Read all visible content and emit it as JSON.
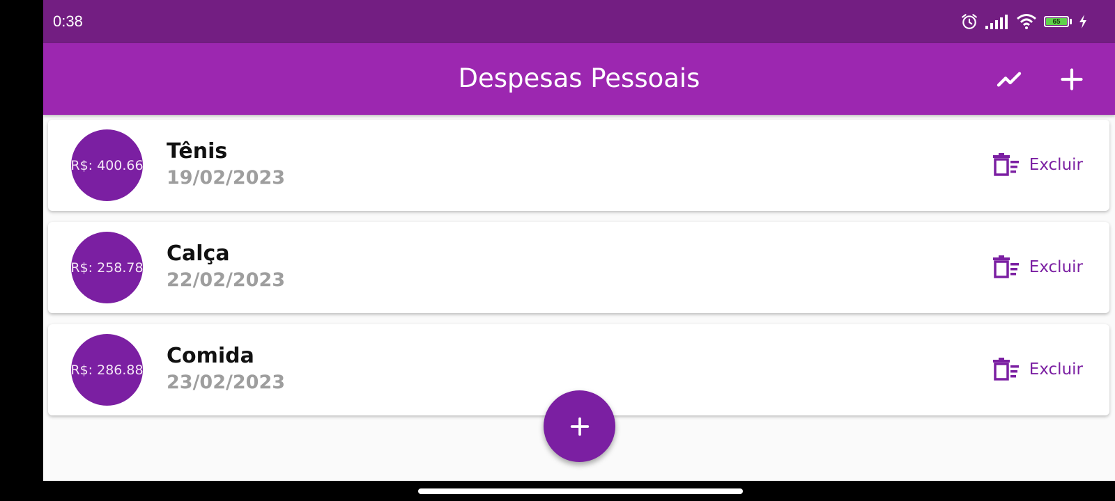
{
  "status_bar": {
    "time": "0:38",
    "battery_level": "65",
    "icons": [
      "alarm-icon",
      "signal-icon",
      "wifi-icon",
      "battery-icon",
      "charging-icon"
    ]
  },
  "app_bar": {
    "title": "Despesas Pessoais",
    "actions": [
      "chart-icon",
      "add-icon"
    ]
  },
  "transactions": [
    {
      "value_label": "R$: 400.66",
      "title": "Tênis",
      "date": "19/02/2023",
      "delete_label": "Excluir"
    },
    {
      "value_label": "R$: 258.78",
      "title": "Calça",
      "date": "22/02/2023",
      "delete_label": "Excluir"
    },
    {
      "value_label": "R$: 286.88",
      "title": "Comida",
      "date": "23/02/2023",
      "delete_label": "Excluir"
    }
  ],
  "fab": {
    "icon": "add-icon"
  },
  "colors": {
    "status_bar": "#731e82",
    "app_bar": "#9c27b0",
    "primary": "#7b1fa2",
    "date_text": "#9e9e9e"
  }
}
